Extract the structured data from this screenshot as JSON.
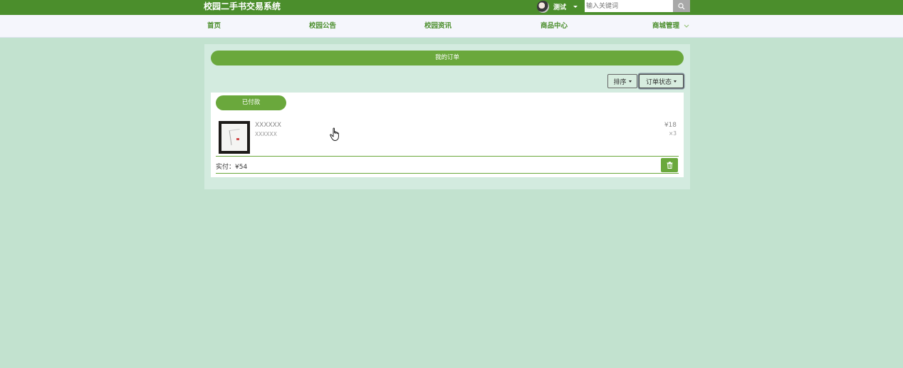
{
  "header": {
    "site_title": "校园二手书交易系统",
    "username": "测试",
    "search_placeholder": "输入关键词"
  },
  "nav": {
    "items": [
      {
        "label": "首页"
      },
      {
        "label": "校园公告"
      },
      {
        "label": "校园资讯"
      },
      {
        "label": "商品中心"
      },
      {
        "label": "商城管理"
      }
    ]
  },
  "orders": {
    "title": "我的订单",
    "sort_label": "排序",
    "status_filter_label": "订单状态",
    "list": [
      {
        "status": "已付款",
        "product_name": "XXXXXX",
        "product_desc": "XXXXXX",
        "price": "¥18",
        "quantity": "×3",
        "total": "实付：¥54"
      }
    ]
  },
  "colors": {
    "brand_green": "#4b8e2c",
    "accent_green": "#6aa83c",
    "page_bg": "#c2e2cf"
  },
  "icons": [
    "search-icon",
    "chevron-down-icon",
    "trash-icon",
    "pointer-hand-icon"
  ]
}
